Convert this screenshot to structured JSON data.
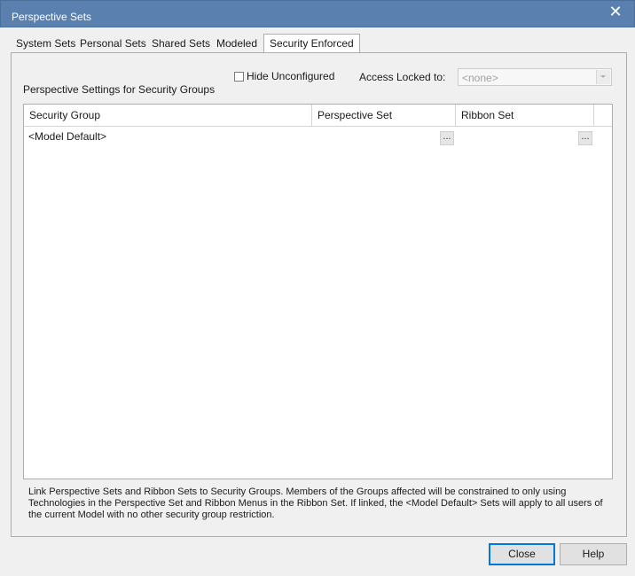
{
  "window": {
    "title": "Perspective Sets",
    "close_glyph": "✕"
  },
  "tabs": [
    {
      "label": "System Sets",
      "active": false
    },
    {
      "label": "Personal Sets",
      "active": false
    },
    {
      "label": "Shared Sets",
      "active": false
    },
    {
      "label": "Modeled",
      "active": false
    },
    {
      "label": "Security Enforced",
      "active": true
    }
  ],
  "options": {
    "hide_unconfigured_label": "Hide Unconfigured",
    "hide_unconfigured_checked": false,
    "access_locked_label": "Access Locked to:",
    "access_locked_value": "<none>",
    "access_locked_enabled": false
  },
  "section_label": "Perspective Settings for Security Groups",
  "grid": {
    "columns": [
      "Security Group",
      "Perspective Set",
      "Ribbon Set"
    ],
    "rows": [
      {
        "security_group": "<Model Default>",
        "perspective_set": "",
        "ribbon_set": "",
        "browse_label": "..."
      }
    ]
  },
  "footer_text": "Link Perspective Sets and Ribbon Sets to Security Groups. Members of the Groups affected will be constrained to only using Technologies in the Perspective Set and Ribbon Menus in the Ribbon Set. If linked, the <Model Default> Sets will apply to all users of the current Model with no other security group restriction.",
  "buttons": {
    "close": "Close",
    "help": "Help"
  },
  "colors": {
    "titlebar": "#5a80b0",
    "focus_border": "#0078d7"
  }
}
